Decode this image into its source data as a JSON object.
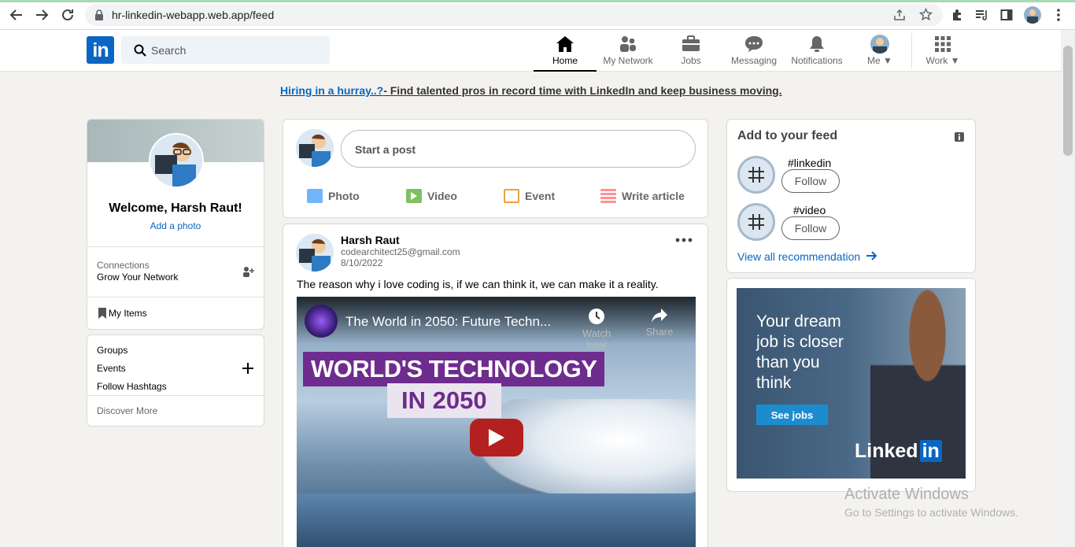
{
  "browser": {
    "url": "hr-linkedin-webapp.web.app/feed",
    "icons": [
      "back-icon",
      "forward-icon",
      "reload-icon",
      "lock-icon",
      "share-icon",
      "star-icon",
      "extensions-icon",
      "reading-list-icon",
      "side-panel-icon",
      "profile-icon",
      "menu-icon"
    ]
  },
  "header": {
    "logo": "in",
    "search_placeholder": "Search",
    "nav": [
      {
        "label": "Home",
        "icon": "home-icon"
      },
      {
        "label": "My Network",
        "icon": "network-icon"
      },
      {
        "label": "Jobs",
        "icon": "briefcase-icon"
      },
      {
        "label": "Messaging",
        "icon": "messaging-icon"
      },
      {
        "label": "Notifications",
        "icon": "bell-icon"
      },
      {
        "label": "Me",
        "icon": "avatar"
      },
      {
        "label": "Work",
        "icon": "grid-icon"
      }
    ]
  },
  "banner": {
    "link": "Hiring in a hurray..?",
    "text": "- Find talented pros in record time with LinkedIn and keep business moving."
  },
  "profile": {
    "welcome": "Welcome, Harsh Raut!",
    "add_photo": "Add a photo",
    "connections_label": "Connections",
    "grow_network": "Grow Your Network",
    "my_items": "My Items"
  },
  "side": {
    "groups": "Groups",
    "events": "Events",
    "follow_hashtags": "Follow Hashtags",
    "discover": "Discover More"
  },
  "composer": {
    "start_post": "Start a post",
    "actions": [
      {
        "label": "Photo",
        "color": "#70b5f9"
      },
      {
        "label": "Video",
        "color": "#7fc15e"
      },
      {
        "label": "Event",
        "color": "#e7a33e"
      },
      {
        "label": "Write article",
        "color": "#fc9295"
      }
    ]
  },
  "post": {
    "author": "Harsh Raut",
    "email": "codearchitect25@gmail.com",
    "date": "8/10/2022",
    "body": "The reason why i love coding is, if we can think it, we can make it a reality.",
    "video": {
      "title": "The World in 2050: Future Techn...",
      "watch_later": "Watch later",
      "share": "Share",
      "headline1": "WORLD'S TECHNOLOGY",
      "headline2": "IN 2050"
    }
  },
  "feed": {
    "title": "Add to your feed",
    "items": [
      {
        "tag": "#linkedin",
        "follow": "Follow"
      },
      {
        "tag": "#video",
        "follow": "Follow"
      }
    ],
    "view_all": "View all recommendation"
  },
  "ad": {
    "text": "Your dream job is closer than you think",
    "button": "See jobs",
    "brand": "Linked",
    "brand_in": "in"
  },
  "watermark": {
    "line1": "Activate Windows",
    "line2": "Go to Settings to activate Windows."
  }
}
